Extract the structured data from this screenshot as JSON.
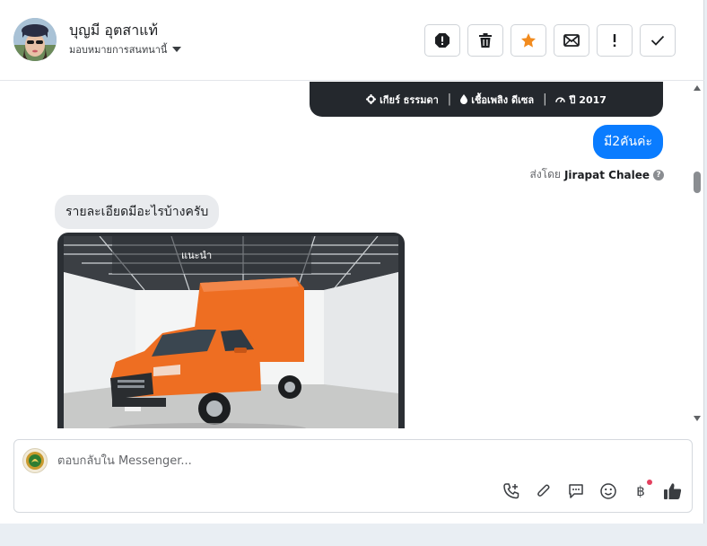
{
  "header": {
    "contact_name": "บุญมี อุตสาแท้",
    "assign_label": "มอบหมายการสนทนานี้"
  },
  "thread": {
    "car_specs": {
      "gear": "เกียร์ ธรรมดา",
      "fuel": "เชื้อเพลิง ดีเซล",
      "year": "ปี 2017"
    },
    "outgoing_message": "มี2คันค่ะ",
    "sent_by_prefix": "ส่งโดย",
    "sent_by_name": "Jirapat Chalee",
    "incoming_message": "รายละเอียดมีอะไรบ้างครับ",
    "image_tag": "แนะนำ"
  },
  "composer": {
    "placeholder": "ตอบกลับใน Messenger...",
    "baht_symbol": "฿"
  },
  "colors": {
    "accent_blue": "#0a7cff",
    "star_orange": "#f28b1e",
    "truck_orange": "#ee6e22"
  }
}
